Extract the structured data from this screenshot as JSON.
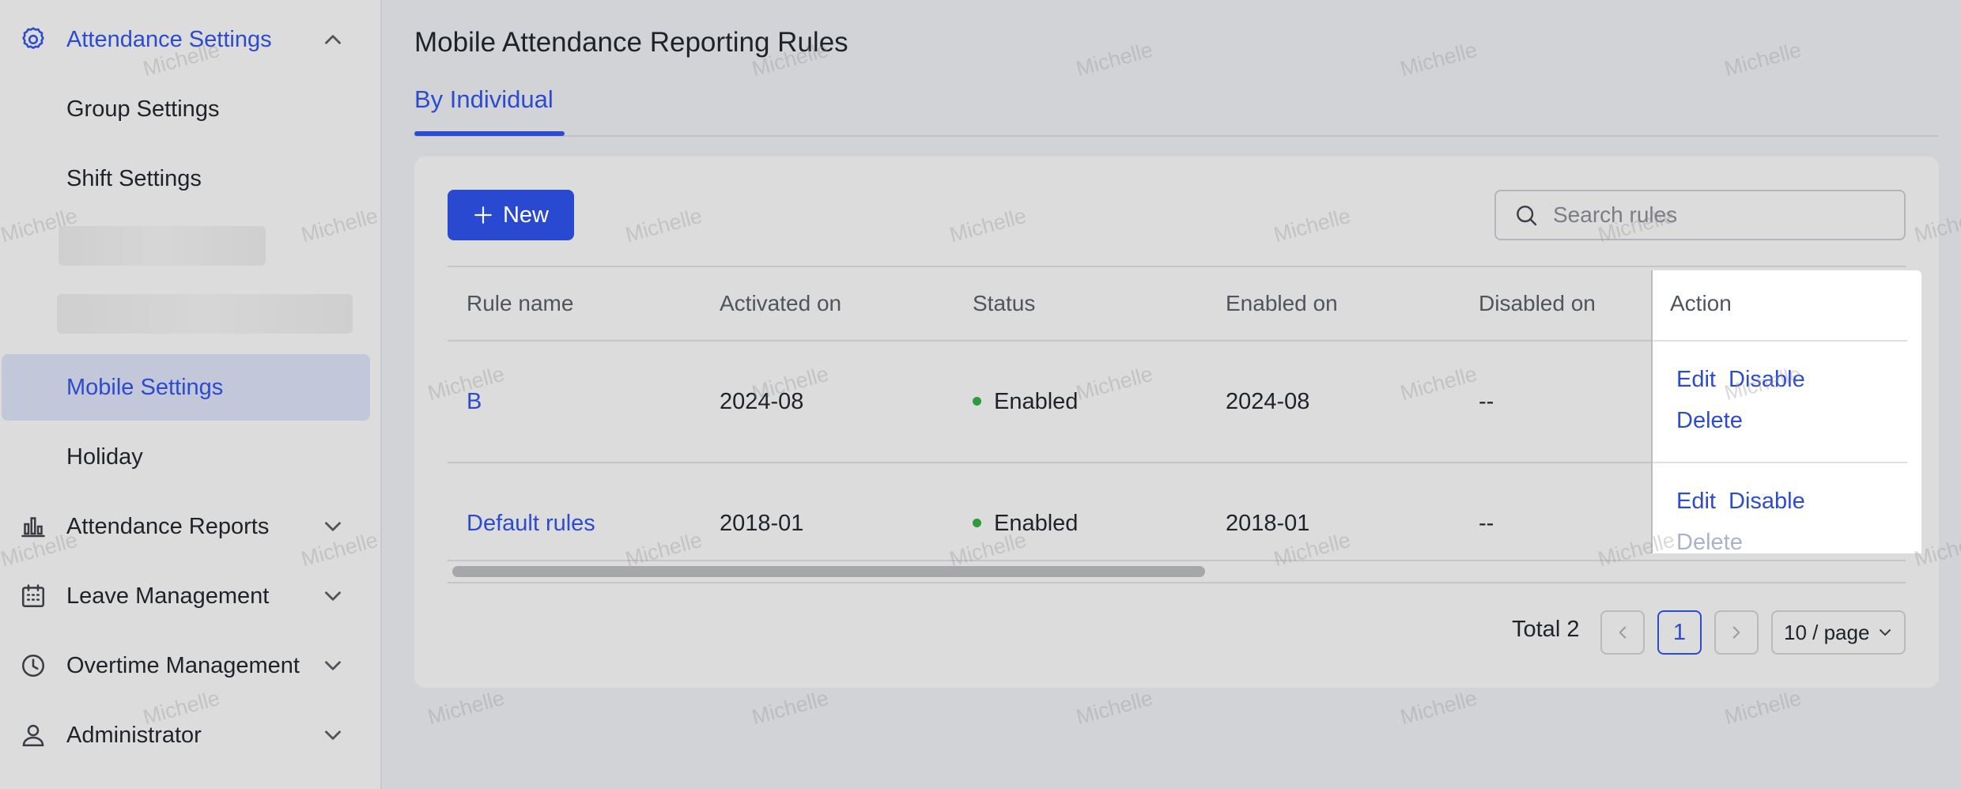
{
  "sidebar": {
    "attendance_settings": "Attendance Settings",
    "group_settings": "Group Settings",
    "shift_settings": "Shift Settings",
    "mobile_settings": "Mobile Settings",
    "holiday": "Holiday",
    "attendance_reports": "Attendance Reports",
    "leave_management": "Leave Management",
    "overtime_management": "Overtime Management",
    "administrator": "Administrator"
  },
  "page": {
    "title": "Mobile Attendance Reporting Rules",
    "tab_label": "By Individual"
  },
  "toolbar": {
    "new_label": "New",
    "search_placeholder": "Search rules"
  },
  "table": {
    "columns": [
      "Rule name",
      "Activated on",
      "Status",
      "Enabled on",
      "Disabled on",
      "Action"
    ],
    "rows": [
      {
        "name": "B",
        "activated": "2024-08",
        "status": "Enabled",
        "enabled": "2024-08",
        "disabled": "--"
      },
      {
        "name": "Default rules",
        "activated": "2018-01",
        "status": "Enabled",
        "enabled": "2018-01",
        "disabled": "--"
      }
    ],
    "actions": {
      "edit": "Edit",
      "disable": "Disable",
      "delete": "Delete"
    }
  },
  "pagination": {
    "total": "Total 2",
    "current_page": "1",
    "page_size": "10 / page"
  },
  "watermark": "Michelle",
  "colors": {
    "accent": "#2d4bcf",
    "primary_button": "#2949d1",
    "status_enabled": "#2e9b3c"
  }
}
